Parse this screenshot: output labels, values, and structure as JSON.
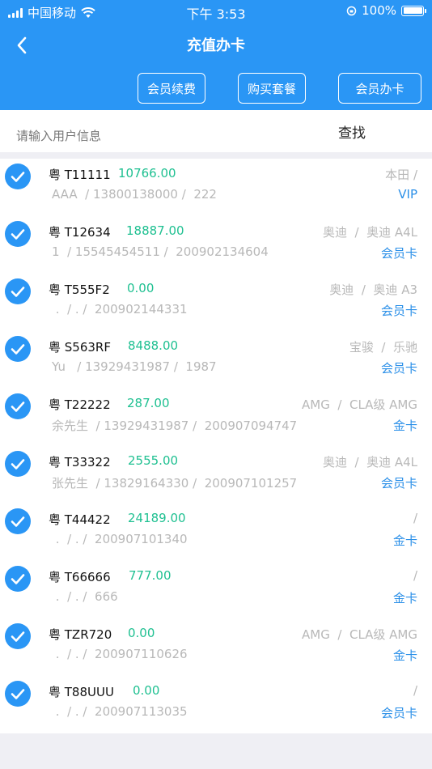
{
  "status_bar": {
    "carrier": "中国移动",
    "time": "下午 3:53",
    "battery": "100%"
  },
  "nav": {
    "title": "充值办卡"
  },
  "actions": {
    "renew": "会员续费",
    "package": "购买套餐",
    "card": "会员办卡"
  },
  "search": {
    "placeholder": "请输入用户信息",
    "button": "查找"
  },
  "colors": {
    "primary": "#2a96f5",
    "amount": "#1fc091",
    "level": "#2a8fe8",
    "muted": "#b8b8b8"
  },
  "members": [
    {
      "plate": "粤 T11111",
      "amount": "10766.00",
      "brand": "本田 /",
      "info": "AAA  / 13800138000 /  222",
      "level": "VIP"
    },
    {
      "plate": "粤 T12634",
      "amount": "18887.00",
      "brand": "奥迪  /  奥迪 A4L",
      "info": "1  / 15545454511 /  200902134604",
      "level": "会员卡"
    },
    {
      "plate": "粤 T555F2",
      "amount": "0.00",
      "brand": "奥迪  /  奥迪 A3",
      "info": " .  / . /  200902144331",
      "level": "会员卡"
    },
    {
      "plate": "粤 S563RF",
      "amount": "8488.00",
      "brand": "宝骏  /  乐驰",
      "info": "Yu   / 13929431987 /  1987",
      "level": "会员卡"
    },
    {
      "plate": "粤 T22222",
      "amount": "287.00",
      "brand": "AMG  /  CLA级 AMG",
      "info": "余先生  / 13929431987 /  200907094747",
      "level": "金卡"
    },
    {
      "plate": "粤 T33322",
      "amount": "2555.00",
      "brand": "奥迪  /  奥迪 A4L",
      "info": "张先生  / 13829164330 /  200907101257",
      "level": "会员卡"
    },
    {
      "plate": "粤 T44422",
      "amount": "24189.00",
      "brand": "/",
      "info": " .  / . /  200907101340",
      "level": "金卡"
    },
    {
      "plate": "粤 T66666",
      "amount": "777.00",
      "brand": "/",
      "info": " .  / . /  666",
      "level": "金卡"
    },
    {
      "plate": "粤 TZR720",
      "amount": "0.00",
      "brand": "AMG  /  CLA级 AMG",
      "info": " .  / . /  200907110626",
      "level": "金卡"
    },
    {
      "plate": "粤 T88UUU",
      "amount": "0.00",
      "brand": "/",
      "info": " .  / . /  200907113035",
      "level": "会员卡"
    }
  ]
}
